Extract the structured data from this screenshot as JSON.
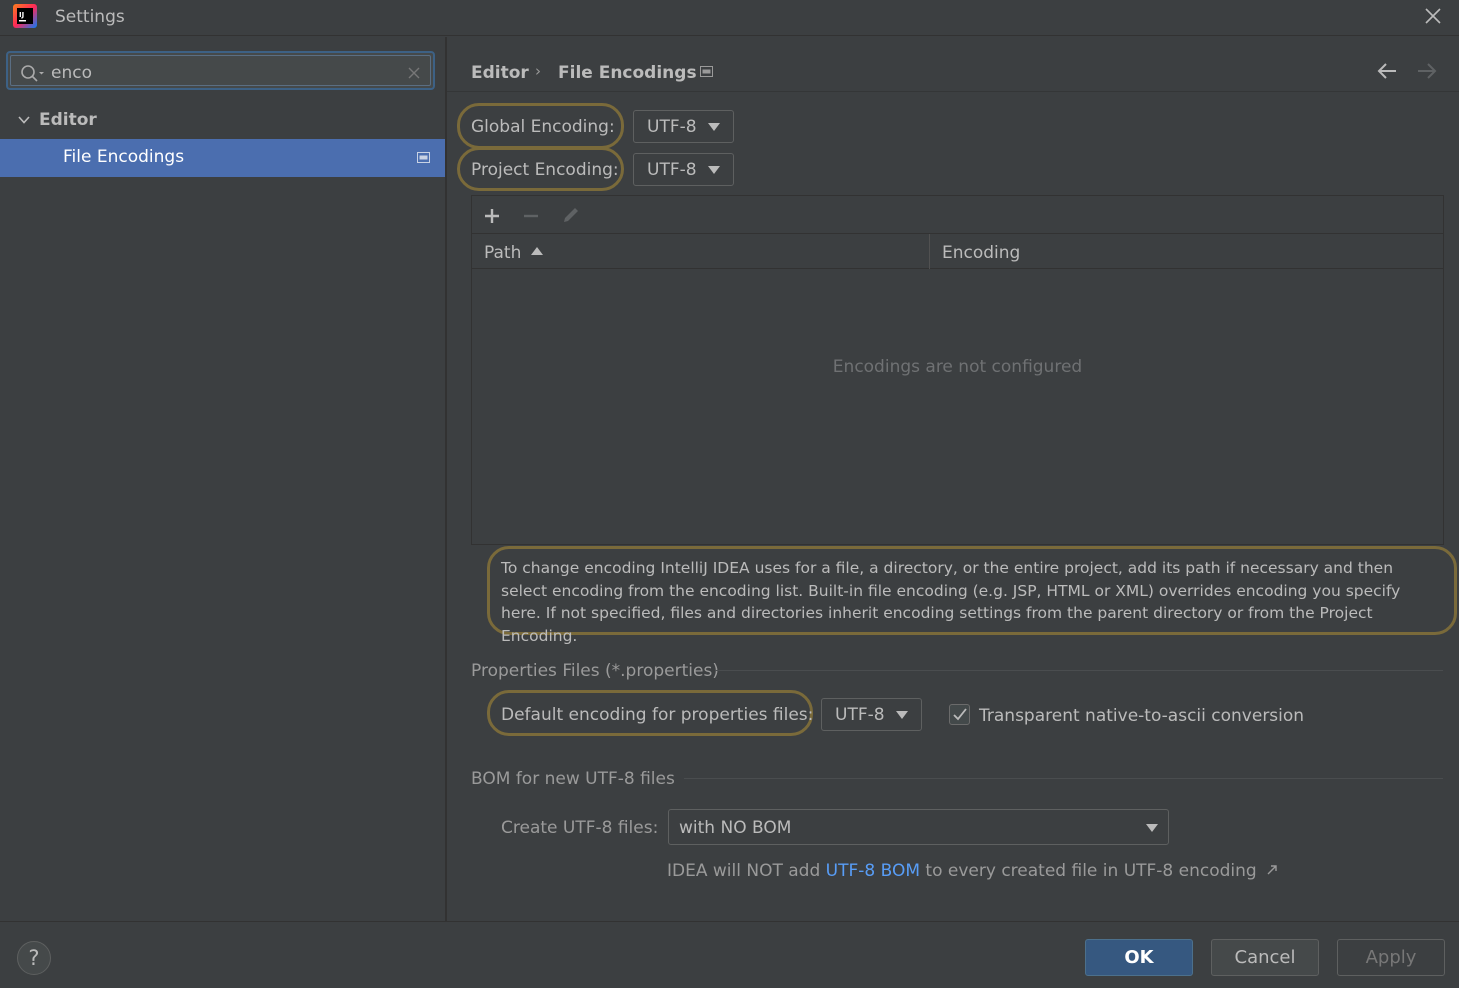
{
  "window": {
    "title": "Settings"
  },
  "sidebar": {
    "search_value": "enco",
    "tree": {
      "group_label": "Editor",
      "item_label": "File Encodings"
    }
  },
  "breadcrumb": {
    "parent": "Editor",
    "separator": "›",
    "current": "File Encodings"
  },
  "encodings": {
    "global_label": "Global Encoding:",
    "global_value": "UTF-8",
    "project_label": "Project Encoding:",
    "project_value": "UTF-8"
  },
  "table": {
    "columns": [
      "Path",
      "Encoding"
    ],
    "empty_text": "Encodings are not configured"
  },
  "info_text": "To change encoding IntelliJ IDEA uses for a file, a directory, or the entire project, add its path if necessary and then select encoding from the encoding list. Built-in file encoding (e.g. JSP, HTML or XML) overrides encoding you specify here. If not specified, files and directories inherit encoding settings from the parent directory or from the Project Encoding.",
  "properties": {
    "section_title": "Properties Files (*.properties)",
    "default_label": "Default encoding for properties files:",
    "default_value": "UTF-8",
    "transparent_label": "Transparent native-to-ascii conversion",
    "transparent_checked": true
  },
  "bom": {
    "section_title": "BOM for new UTF-8 files",
    "create_label": "Create UTF-8 files:",
    "create_value": "with NO BOM",
    "note_before": "IDEA will NOT add ",
    "note_link": "UTF-8 BOM",
    "note_after": " to every created file in UTF-8 encoding"
  },
  "footer": {
    "help": "?",
    "ok": "OK",
    "cancel": "Cancel",
    "apply": "Apply"
  },
  "colors": {
    "accent": "#4b6eaf",
    "highlight_outline": "#7a6a3a",
    "link": "#589df6",
    "ok_button": "#365880"
  }
}
